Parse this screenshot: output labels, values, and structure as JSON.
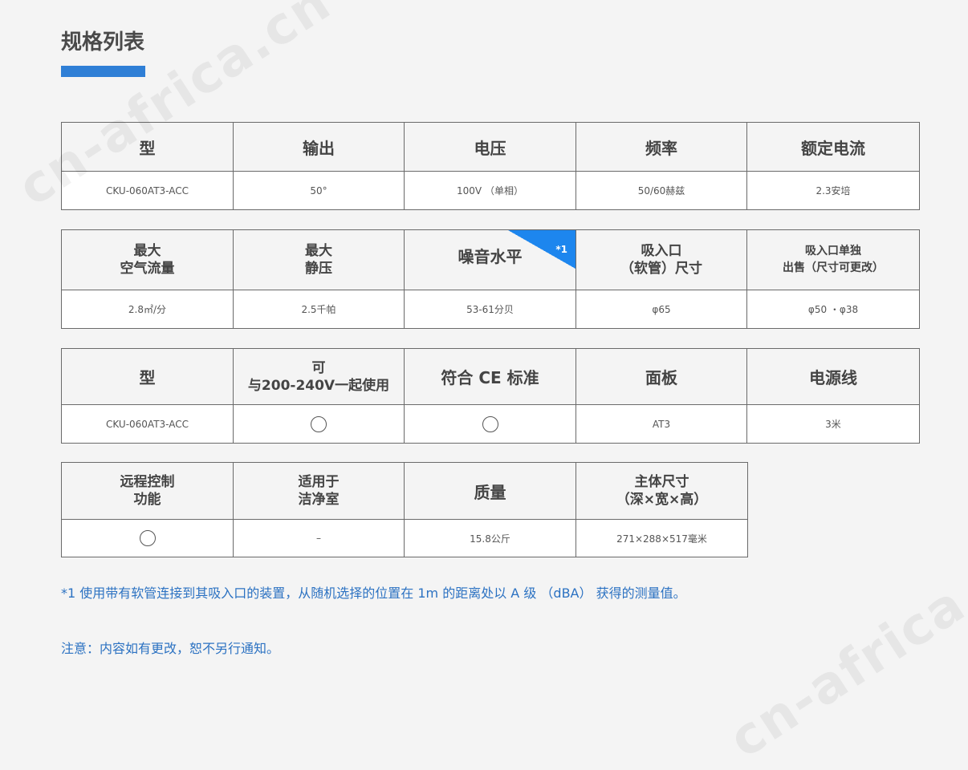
{
  "title": "规格列表",
  "tables": [
    {
      "headers": [
        "型",
        "输出",
        "电压",
        "频率",
        "额定电流"
      ],
      "values": [
        "CKU-060AT3-ACC",
        "50°",
        "100V （单相）",
        "50/60赫兹",
        "2.3安培"
      ]
    },
    {
      "headers": [
        {
          "line1": "最大",
          "line2": "空气流量"
        },
        {
          "line1": "最大",
          "line2": "静压"
        },
        {
          "label": "噪音水平",
          "badge": "*1"
        },
        {
          "line1": "吸入口",
          "line2": "（软管）尺寸"
        },
        {
          "line1": "吸入口单独",
          "line2": "出售（尺寸可更改）"
        }
      ],
      "values": [
        "2.8㎡/分",
        "2.5千帕",
        "53-61分贝",
        "φ65",
        "φ50 ・φ38"
      ]
    },
    {
      "headers": [
        "型",
        {
          "line1": "可",
          "line2": "与200-240V一起使用"
        },
        "符合 CE 标准",
        "面板",
        "电源线"
      ],
      "values": [
        "CKU-060AT3-ACC",
        "○",
        "○",
        "AT3",
        "3米"
      ]
    },
    {
      "headers": [
        {
          "line1": "远程控制",
          "line2": "功能"
        },
        {
          "line1": "适用于",
          "line2": "洁净室"
        },
        "质量",
        {
          "line1": "主体尺寸",
          "line2": "（深×宽×高）"
        }
      ],
      "values": [
        "○",
        "–",
        "15.8公斤",
        "271×288×517毫米"
      ]
    }
  ],
  "footnote": "*1 使用带有软管连接到其吸入口的装置，从随机选择的位置在 1m 的距离处以 A 级 （dBA） 获得的测量值。",
  "notice": "注意：内容如有更改，恕不另行通知。",
  "watermark": "cn-africa.cn",
  "colors": {
    "accent": "#2f7fd6",
    "badge": "#1d86ee",
    "note_text": "#2c72c2"
  }
}
